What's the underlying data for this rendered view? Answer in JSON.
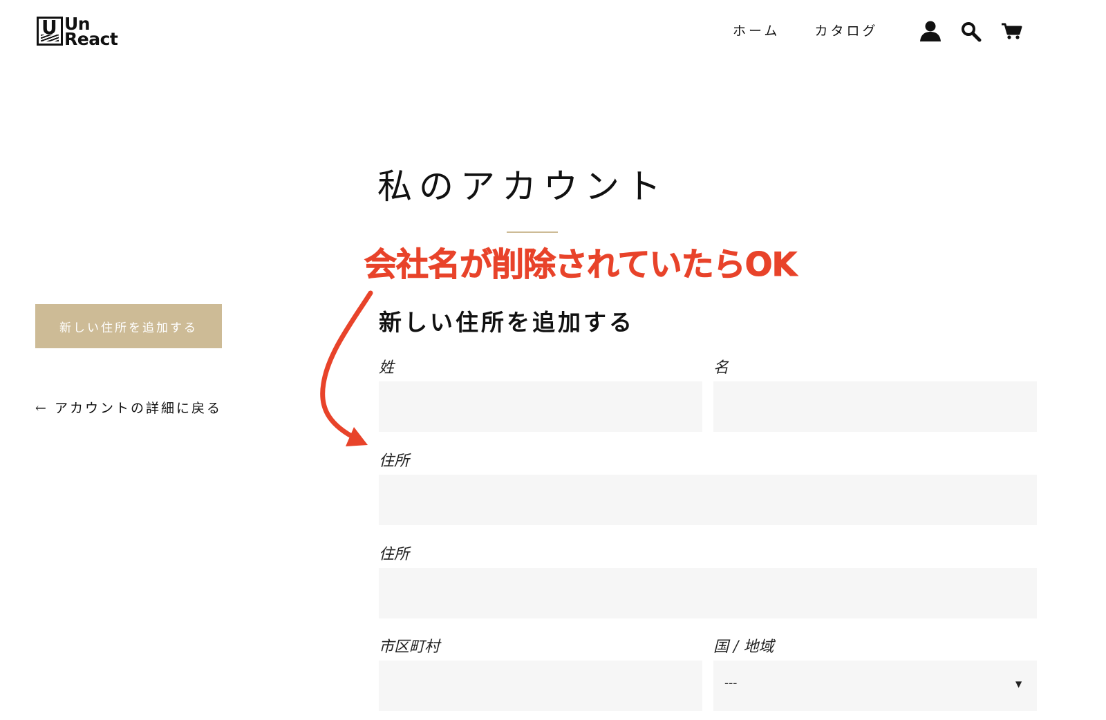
{
  "header": {
    "logo_line1": "Un",
    "logo_line2": "React",
    "logo_mark": "U",
    "nav": {
      "home": "ホーム",
      "catalog": "カタログ"
    },
    "icons": [
      "account-icon",
      "search-icon",
      "cart-icon"
    ]
  },
  "page": {
    "title": "私のアカウント"
  },
  "annotation": {
    "text": "会社名が削除されていたらOK",
    "color": "#e8432a"
  },
  "sidebar": {
    "add_address_button": "新しい住所を追加する",
    "back_link": "← アカウントの詳細に戻る"
  },
  "form": {
    "title": "新しい住所を追加する",
    "last_name_label": "姓",
    "first_name_label": "名",
    "address1_label": "住所",
    "address2_label": "住所",
    "city_label": "市区町村",
    "country_label": "国 / 地域",
    "country_value": "---"
  },
  "colors": {
    "accent": "#cdbb96",
    "input_bg": "#f6f6f6"
  }
}
